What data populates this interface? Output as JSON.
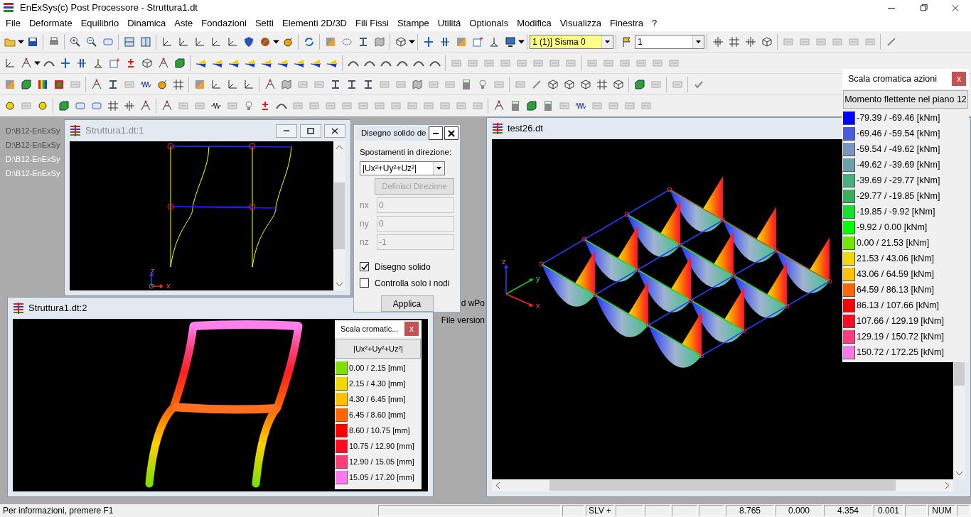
{
  "window": {
    "title": "EnExSys(c) Post Processore - Struttura1.dt"
  },
  "menu": [
    "File",
    "Deformate",
    "Equilibrio",
    "Dinamica",
    "Aste",
    "Fondazioni",
    "Setti",
    "Elementi 2D/3D",
    "Fili Fissi",
    "Stampe",
    "Utilitá",
    "Optionals",
    "Modifica",
    "Visualizza",
    "Finestra",
    "?"
  ],
  "toolbar": {
    "load_case": "1 (1)] Sisma 0",
    "combo_2": "1"
  },
  "recent_files": [
    {
      "text": "D:\\B12-EnExSy",
      "dimmed": true
    },
    {
      "text": "D:\\B12-EnExSy",
      "dimmed": true
    },
    {
      "text": "D:\\B12-EnExSy",
      "dimmed": false
    },
    {
      "text": "D:\\B12-EnExSy",
      "dimmed": false
    }
  ],
  "background_texts": [
    "d wPo",
    "File version"
  ],
  "windows": [
    {
      "kind": "frame",
      "title": "Struttura1.dt:1",
      "dimmed": true,
      "axis_labels": [
        "z",
        "x"
      ]
    },
    {
      "kind": "deformed",
      "title": "Struttura1.dt:2",
      "dimmed": false,
      "scale": {
        "title": "Scala cromatic...",
        "close": "x",
        "heading": "|Ux²+Uy²+Uz²|",
        "items": [
          {
            "color": "#7fe000",
            "label": "0.00 / 2.15 [mm]"
          },
          {
            "color": "#f0d800",
            "label": "2.15 / 4.30 [mm]"
          },
          {
            "color": "#ffc000",
            "label": "4.30 / 6.45 [mm]"
          },
          {
            "color": "#ff6600",
            "label": "6.45 / 8.60 [mm]"
          },
          {
            "color": "#ff0000",
            "label": "8.60 / 10.75 [mm]"
          },
          {
            "color": "#ff0a1e",
            "label": "10.75 / 12.90 [mm]"
          },
          {
            "color": "#ff3c7c",
            "label": "12.90 / 15.05 [mm]"
          },
          {
            "color": "#ff78ec",
            "label": "15.05 / 17.20 [mm]"
          }
        ]
      }
    },
    {
      "kind": "moments",
      "title": "test26.dt",
      "dimmed": false,
      "axis_labels": [
        "z",
        "y",
        "x"
      ]
    }
  ],
  "dialog": {
    "title": "Disegno solido de",
    "direction_label": "Spostamenti in direzione:",
    "direction_value": "|Ux²+Uy²+Uz²|",
    "define_button": {
      "label": "Definisci Direzione",
      "disabled": true
    },
    "fields": [
      {
        "label": "nx",
        "value": "0",
        "disabled": true
      },
      {
        "label": "ny",
        "value": "0",
        "disabled": true
      },
      {
        "label": "nz",
        "value": "-1",
        "disabled": true
      }
    ],
    "checks": [
      {
        "label": "Disegno solido",
        "checked": true
      },
      {
        "label": "Controlla solo i nodi",
        "checked": false
      }
    ],
    "apply_button": "Applica"
  },
  "action_scale": {
    "title": "Scala cromatica azioni",
    "close": "x",
    "heading": "Momento flettente nel piano 12",
    "items": [
      {
        "color": "#0000ff",
        "label": "-79.39 / -69.46 [kNm]"
      },
      {
        "color": "#4a5ad8",
        "label": "-69.46 / -59.54 [kNm]"
      },
      {
        "color": "#7a94c0",
        "label": "-59.54 / -49.62 [kNm]"
      },
      {
        "color": "#6aa0a8",
        "label": "-49.62 / -39.69 [kNm]"
      },
      {
        "color": "#48b080",
        "label": "-39.69 / -29.77 [kNm]"
      },
      {
        "color": "#38b060",
        "label": "-29.77 / -19.85 [kNm]"
      },
      {
        "color": "#18e030",
        "label": "-19.85 / -9.92 [kNm]"
      },
      {
        "color": "#00ff00",
        "label": "-9.92 / 0.00 [kNm]"
      },
      {
        "color": "#70e800",
        "label": "0.00 / 21.53 [kNm]"
      },
      {
        "color": "#f0d800",
        "label": "21.53 / 43.06 [kNm]"
      },
      {
        "color": "#ffc000",
        "label": "43.06 / 64.59 [kNm]"
      },
      {
        "color": "#ff6600",
        "label": "64.59 / 86.13 [kNm]"
      },
      {
        "color": "#ff0000",
        "label": "86.13 / 107.66 [kNm]"
      },
      {
        "color": "#ff0a20",
        "label": "107.66 / 129.19 [kNm]"
      },
      {
        "color": "#ff3c7c",
        "label": "129.19 / 150.72 [kNm]"
      },
      {
        "color": "#ff78ec",
        "label": "150.72 / 172.25 [kNm]"
      }
    ]
  },
  "status_bar": {
    "message": "Per informazioni, premere F1",
    "panes": [
      "SLV +",
      "8.765",
      "0.000",
      "4.354",
      "0.001",
      "NUM"
    ]
  }
}
